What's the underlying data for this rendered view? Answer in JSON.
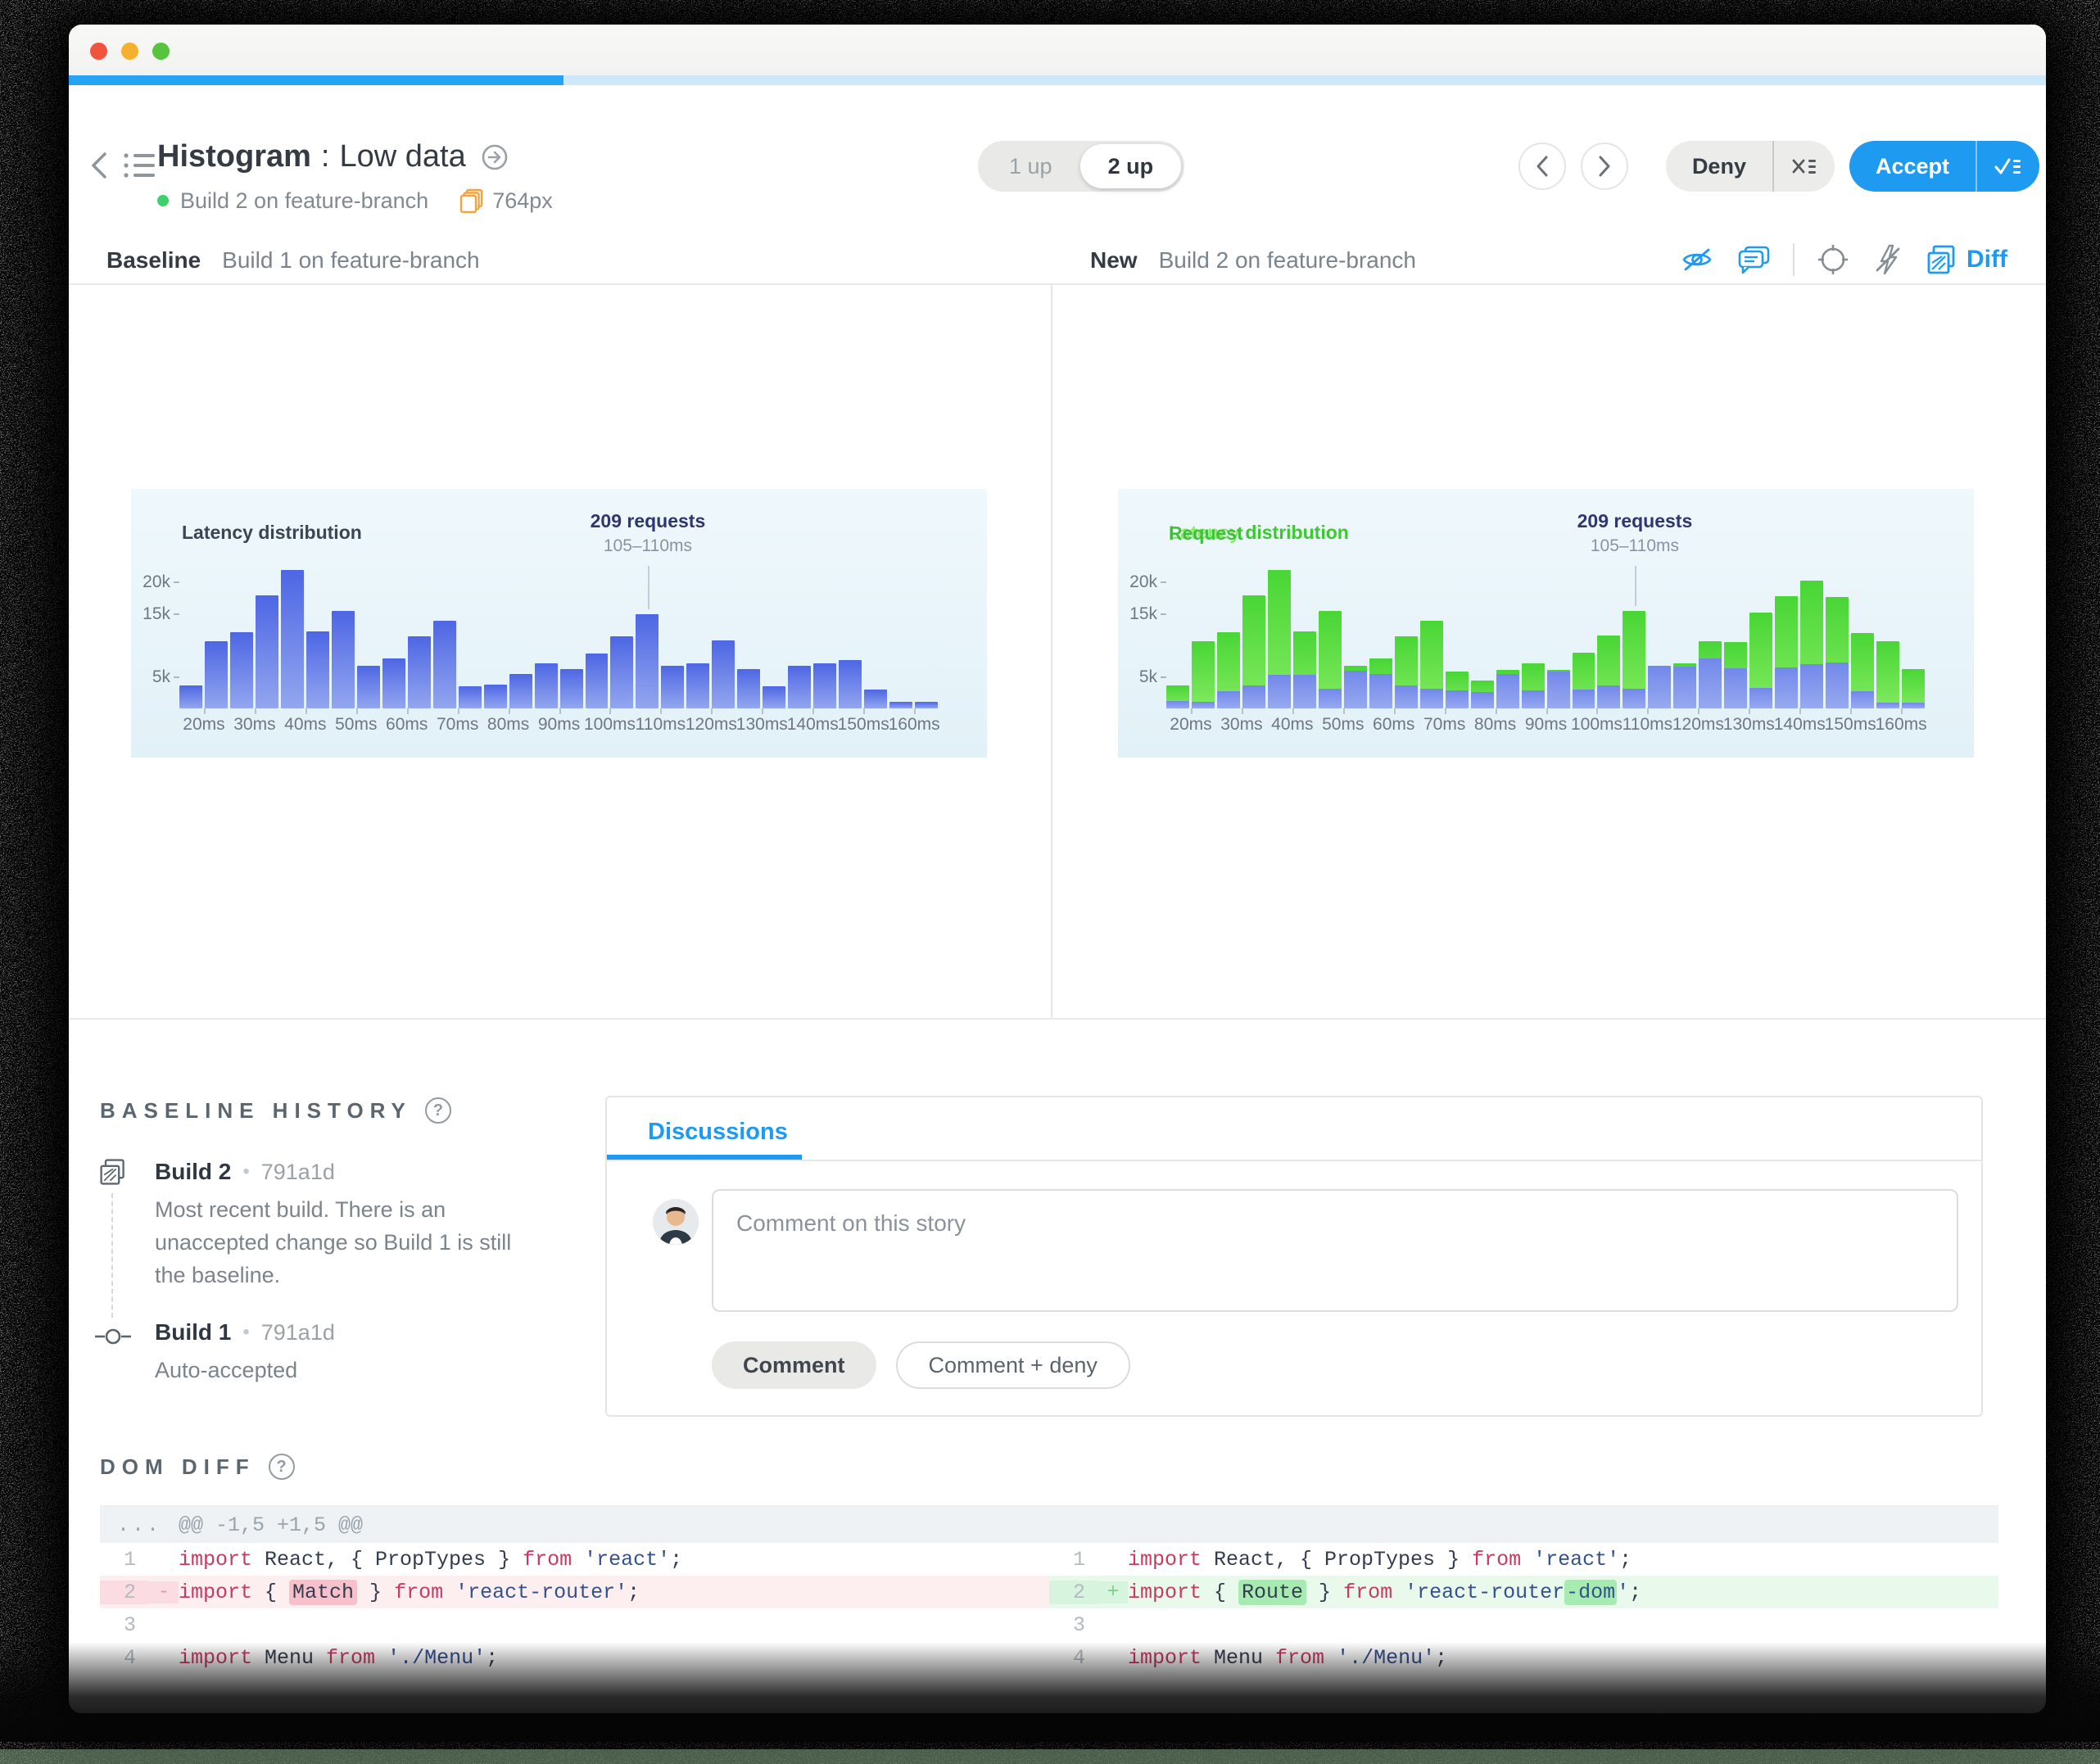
{
  "header": {
    "title": "Histogram",
    "separator": ":",
    "variant": "Low data",
    "build_status": "Build 2 on feature-branch",
    "width_label": "764px",
    "toggle": {
      "options": [
        "1 up",
        "2 up"
      ],
      "selected": "2 up"
    },
    "deny_label": "Deny",
    "accept_label": "Accept"
  },
  "compare": {
    "baseline_label": "Baseline",
    "baseline_build": "Build 1 on feature-branch",
    "new_label": "New",
    "new_build": "Build 2 on feature-branch",
    "diff_label": "Diff"
  },
  "chart_data": [
    {
      "type": "bar",
      "title": "Latency distribution",
      "bin_width_ms": 5,
      "bin_start_ms": 15,
      "x_tick_labels": [
        "20ms",
        "30ms",
        "40ms",
        "50ms",
        "60ms",
        "70ms",
        "80ms",
        "90ms",
        "100ms",
        "110ms",
        "120ms",
        "130ms",
        "140ms",
        "150ms",
        "160ms"
      ],
      "y_ticks": [
        {
          "label": "5k",
          "value": 5
        },
        {
          "label": "15k",
          "value": 15
        },
        {
          "label": "20k",
          "value": 20
        }
      ],
      "ylim": [
        0,
        27
      ],
      "values_thousands": [
        3.7,
        10.6,
        12.1,
        17.9,
        22,
        12.2,
        15.5,
        6.7,
        7.9,
        11.4,
        13.9,
        3.5,
        3.8,
        5.4,
        7.2,
        6.2,
        8.7,
        11.4,
        15,
        6.7,
        7.2,
        10.8,
        6.2,
        3.5,
        6.7,
        7.2,
        7.7,
        3,
        1.1,
        1.1
      ],
      "annotation": {
        "label": "209 requests",
        "range": "105–110ms",
        "bar_index": 18
      },
      "bar_color": "#5b74e8"
    },
    {
      "type": "bar-overlay-diff",
      "title": "Request distribution",
      "title_words": {
        "old": "Latency",
        "new": "Request",
        "rest": " distribution"
      },
      "bin_width_ms": 5,
      "bin_start_ms": 15,
      "x_tick_labels": [
        "20ms",
        "30ms",
        "40ms",
        "50ms",
        "60ms",
        "70ms",
        "80ms",
        "90ms",
        "100ms",
        "110ms",
        "120ms",
        "130ms",
        "140ms",
        "150ms",
        "160ms"
      ],
      "y_ticks": [
        {
          "label": "5k",
          "value": 5
        },
        {
          "label": "15k",
          "value": 15
        },
        {
          "label": "20k",
          "value": 20
        }
      ],
      "ylim": [
        0,
        27
      ],
      "series": [
        {
          "name": "new-changed-pixels",
          "color": "#55dd3f",
          "values": [
            3.7,
            10.6,
            12.1,
            17.9,
            22,
            12.2,
            15.5,
            6.7,
            7.9,
            11.4,
            13.9,
            5.9,
            4.4,
            6.1,
            7.2,
            6.1,
            8.8,
            11.5,
            15.4,
            6.8,
            7.1,
            10.7,
            10.5,
            15.2,
            17.8,
            20.2,
            17.6,
            12,
            10.7,
            6.3
          ]
        },
        {
          "name": "baseline-overlap",
          "color": "#7e92ec",
          "values": [
            1.2,
            1,
            2.7,
            3.7,
            5.3,
            5.3,
            3.1,
            6,
            5.4,
            3.6,
            3.1,
            2.9,
            2.6,
            5.4,
            2.8,
            5.9,
            3,
            3.6,
            3.1,
            6.8,
            6.6,
            7.9,
            6.4,
            3.3,
            6.5,
            7,
            7.3,
            2.7,
            0.9,
            0.9
          ]
        }
      ],
      "annotation": {
        "label": "209 requests",
        "range": "105–110ms",
        "bar_index": 18
      }
    }
  ],
  "baseline_history": {
    "heading": "BASELINE HISTORY",
    "items": [
      {
        "name": "Build 2",
        "hash": "791a1d",
        "description": "Most recent build. There is an unaccepted change so Build 1 is still the baseline."
      },
      {
        "name": "Build 1",
        "hash": "791a1d",
        "description": "Auto-accepted"
      }
    ]
  },
  "discussions": {
    "tab_label": "Discussions",
    "comment_placeholder": "Comment on this story",
    "comment_button": "Comment",
    "comment_deny_button": "Comment + deny"
  },
  "dom_diff": {
    "heading": "DOM DIFF",
    "hunk_gutter": "...",
    "hunk_header": "@@ -1,5 +1,5 @@",
    "left": {
      "lines": [
        {
          "num": "1",
          "marker": "",
          "kind": "ctx",
          "tokens": [
            [
              "k",
              "import"
            ],
            [
              "p",
              " React, { PropTypes } "
            ],
            [
              "k",
              "from"
            ],
            [
              "p",
              " "
            ],
            [
              "s",
              "'react'"
            ],
            [
              "p",
              ";"
            ]
          ]
        },
        {
          "num": "2",
          "marker": "-",
          "kind": "del",
          "tokens": [
            [
              "k",
              "import"
            ],
            [
              "p",
              " { "
            ],
            [
              "hld",
              "Match"
            ],
            [
              "p",
              " } "
            ],
            [
              "k",
              "from"
            ],
            [
              "p",
              " "
            ],
            [
              "s",
              "'react-router'"
            ],
            [
              "p",
              ";"
            ]
          ]
        },
        {
          "num": "3",
          "marker": "",
          "kind": "ctx",
          "tokens": []
        },
        {
          "num": "4",
          "marker": "",
          "kind": "ctx",
          "tokens": [
            [
              "k",
              "import"
            ],
            [
              "p",
              " Menu "
            ],
            [
              "k",
              "from"
            ],
            [
              "p",
              " "
            ],
            [
              "s",
              "'./Menu'"
            ],
            [
              "p",
              ";"
            ]
          ]
        }
      ]
    },
    "right": {
      "lines": [
        {
          "num": "1",
          "marker": "",
          "kind": "ctx",
          "tokens": [
            [
              "k",
              "import"
            ],
            [
              "p",
              " React, { PropTypes } "
            ],
            [
              "k",
              "from"
            ],
            [
              "p",
              " "
            ],
            [
              "s",
              "'react'"
            ],
            [
              "p",
              ";"
            ]
          ]
        },
        {
          "num": "2",
          "marker": "+",
          "kind": "add",
          "tokens": [
            [
              "k",
              "import"
            ],
            [
              "p",
              " { "
            ],
            [
              "hla",
              "Route"
            ],
            [
              "p",
              " } "
            ],
            [
              "k",
              "from"
            ],
            [
              "p",
              " "
            ],
            [
              "s",
              "'react-router"
            ],
            [
              "shla",
              "-dom"
            ],
            [
              "s",
              "'"
            ],
            [
              "p",
              ";"
            ]
          ]
        },
        {
          "num": "3",
          "marker": "",
          "kind": "ctx",
          "tokens": []
        },
        {
          "num": "4",
          "marker": "",
          "kind": "ctx",
          "tokens": [
            [
              "k",
              "import"
            ],
            [
              "p",
              " Menu "
            ],
            [
              "k",
              "from"
            ],
            [
              "p",
              " "
            ],
            [
              "s",
              "'./Menu'"
            ],
            [
              "p",
              ";"
            ]
          ]
        }
      ]
    }
  },
  "icons": {
    "back-icon": "‹",
    "prev-icon": "‹",
    "next-icon": "›",
    "help-icon": "?",
    "item-separator": "•"
  },
  "colors": {
    "accent_blue": "#1e9bf0",
    "progress_track": "#cde9f9",
    "bar_blue": "#5b74e8",
    "diff_green": "#55dd3f",
    "status_green": "#3ed06c",
    "pages_icon_orange": "#f2a33c",
    "del_bg": "#fdeef0",
    "add_bg": "#e9f9ec"
  },
  "window": {
    "progress_percent": 25
  }
}
